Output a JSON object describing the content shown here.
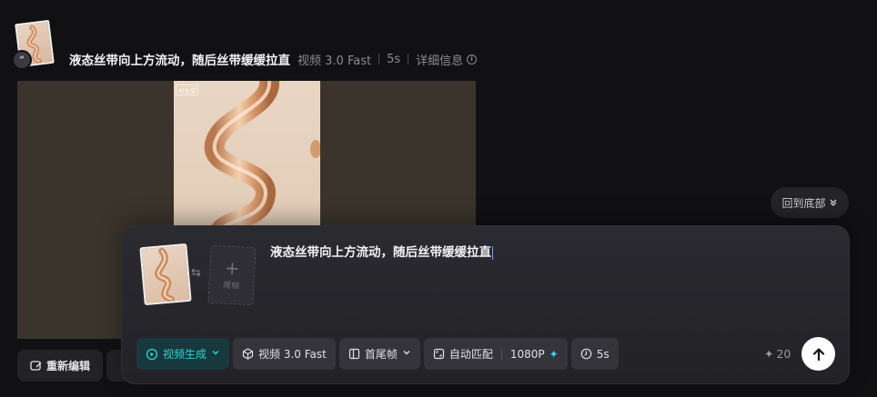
{
  "header": {
    "title": "液态丝带向上方流动，随后丝带缓缓拉直",
    "model": "视频 3.0 Fast",
    "duration": "5s",
    "details_label": "详细信息",
    "badge_text": "“"
  },
  "video": {
    "ai_tag": "AI生成"
  },
  "back_to_bottom": {
    "label": "回到底部"
  },
  "actions": {
    "reedit_label": "重新编辑"
  },
  "composer": {
    "prompt": "液态丝带向上方流动，随后丝带缓缓拉直",
    "last_frame_label": "尾帧",
    "mode": "视频生成",
    "model": "视频 3.0 Fast",
    "frames": "首尾帧",
    "ratio": "自动匹配",
    "resolution": "1080P",
    "duration": "5s",
    "credits": "20"
  },
  "colors": {
    "accent": "#2ed2d6",
    "background": "#111114"
  }
}
